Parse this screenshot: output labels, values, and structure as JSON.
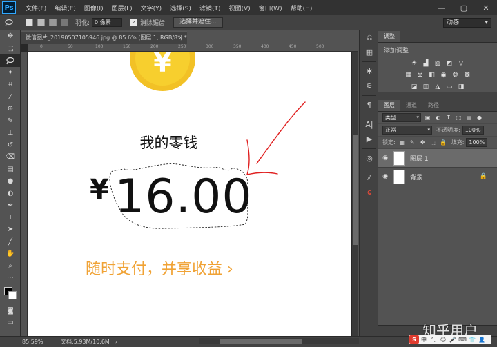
{
  "app": {
    "logo": "Ps",
    "menu": [
      "文件(F)",
      "编辑(E)",
      "图像(I)",
      "图层(L)",
      "文字(Y)",
      "选择(S)",
      "滤镜(T)",
      "视图(V)",
      "窗口(W)",
      "帮助(H)"
    ],
    "window_controls": [
      "—",
      "▢",
      "✕"
    ]
  },
  "options_bar": {
    "feather_label": "羽化:",
    "feather_value": "0 像素",
    "antialias_label": "消除锯齿",
    "select_mask_button": "选择并遮住...",
    "workspace": "动感"
  },
  "document": {
    "tab_title": "微信图片_20190507105946.jpg @ 85.6% (图层 1, RGB/8*) *",
    "tab_close": "×",
    "ruler_ticks": [
      "0",
      "50",
      "100",
      "150",
      "200",
      "250",
      "300",
      "350",
      "400",
      "450",
      "500"
    ]
  },
  "canvas_content": {
    "coin_symbol": "¥",
    "title": "我的零钱",
    "currency": "¥",
    "balance": "16.00",
    "promo": "随时支付，并享收益 ›"
  },
  "panels": {
    "adjust_tab": "调整",
    "adjust_hint": "添加调整",
    "layers_tabs": [
      "图层",
      "通道",
      "路径"
    ],
    "kind_filter": "类型",
    "blend_mode": "正常",
    "opacity_label": "不透明度:",
    "opacity_value": "100%",
    "lock_label": "锁定:",
    "fill_label": "填充:",
    "fill_value": "100%",
    "layers": [
      {
        "name": "图层 1",
        "selected": true,
        "locked": false
      },
      {
        "name": "背景",
        "selected": false,
        "locked": true
      }
    ]
  },
  "statusbar": {
    "zoom": "85.59%",
    "doc_size": "文档:5.93M/10.6M",
    "arrow": "›"
  },
  "watermark": "知乎用户",
  "ime": {
    "logo": "S",
    "items": [
      "中",
      "°,",
      "☺",
      "🎤",
      "⌨",
      "👕",
      "👤",
      "⋯"
    ]
  },
  "colors": {
    "coin": "#f2c126",
    "promo": "#f0a234",
    "annotation_arrow": "#e02020",
    "selection": "#222222",
    "ps_accent": "#31a8ff"
  }
}
